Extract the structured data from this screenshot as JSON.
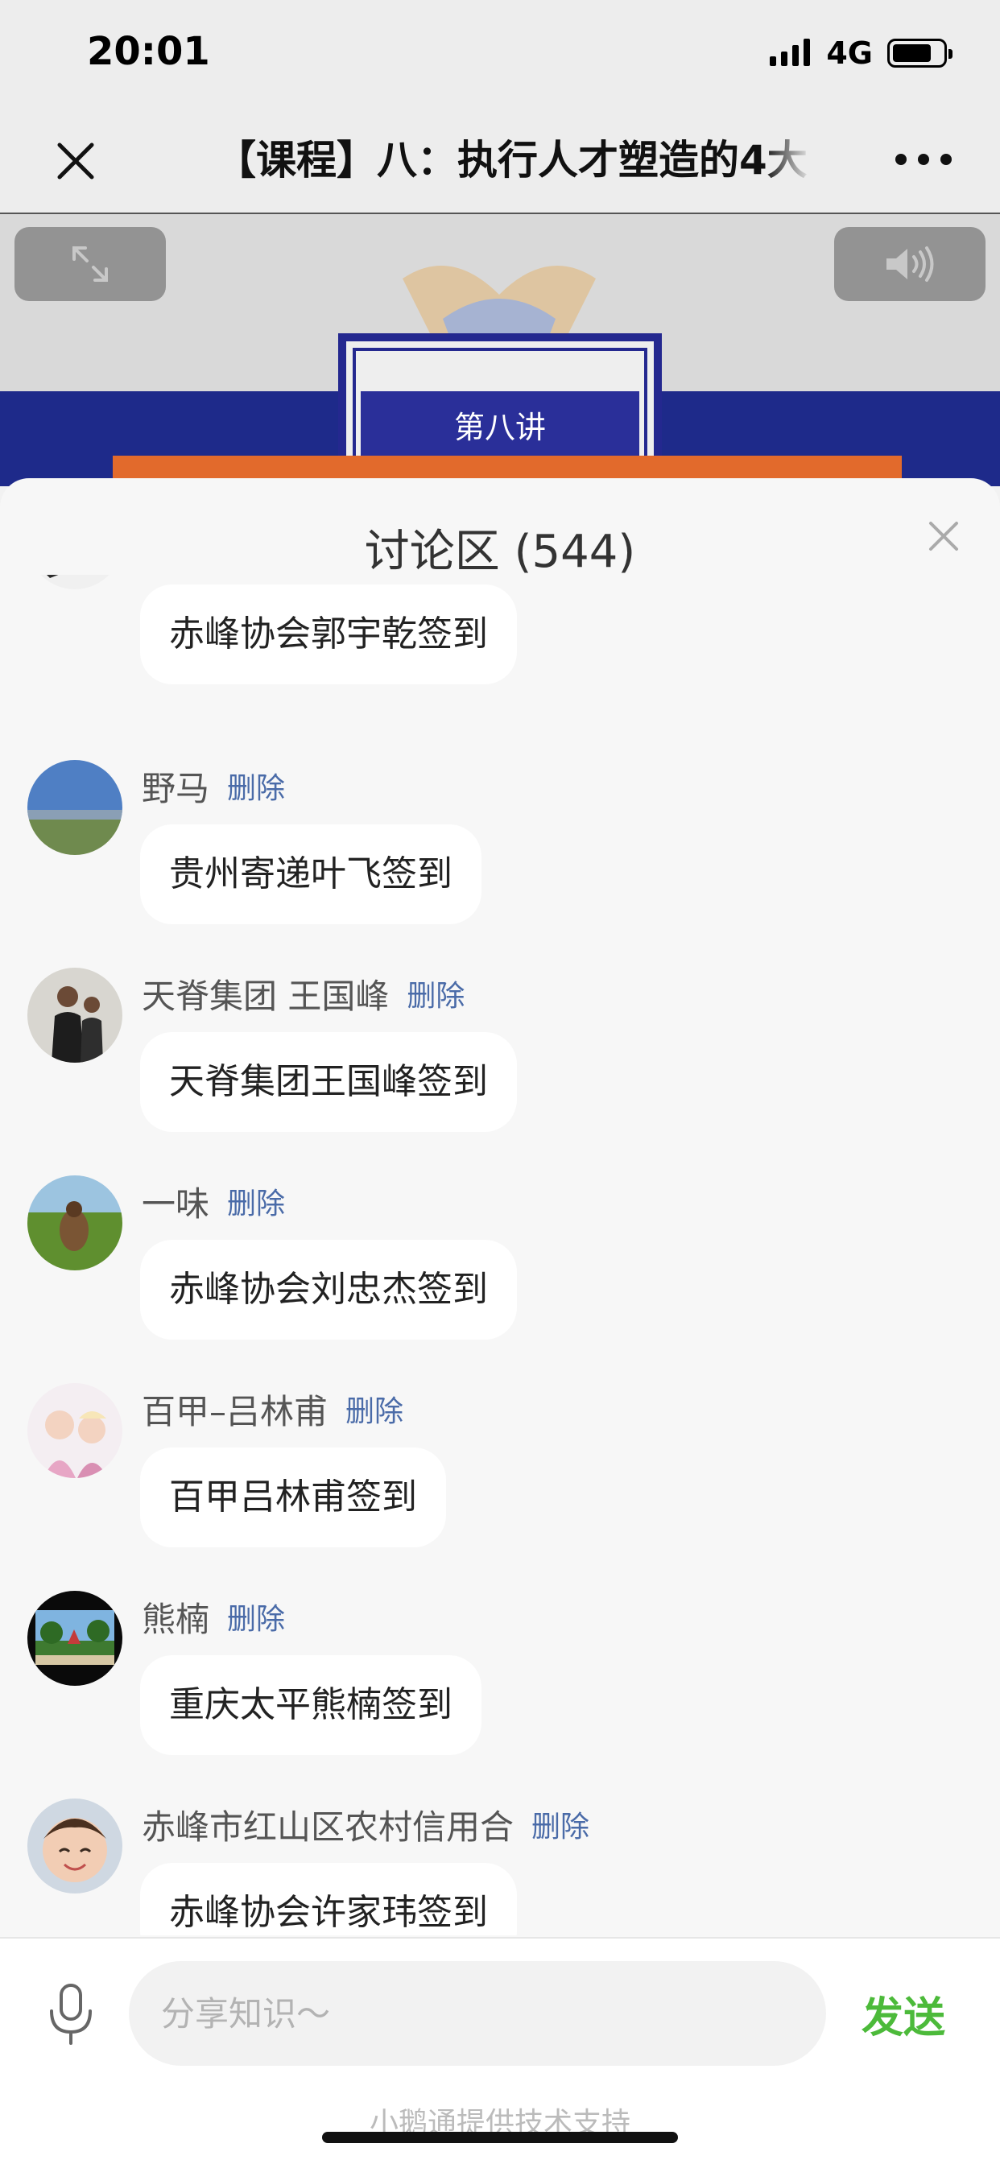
{
  "status_bar": {
    "time": "20:01",
    "network": "4G"
  },
  "nav": {
    "title": "【课程】八：执行人才塑造的4大"
  },
  "video": {
    "caption": "第八讲"
  },
  "discussion": {
    "title": "讨论区 (544)",
    "delete_label": "删除",
    "messages": [
      {
        "name": "",
        "text": "赤峰协会郭宇乾签到"
      },
      {
        "name": "野马",
        "text": "贵州寄递叶飞签到"
      },
      {
        "name": "天脊集团 王国峰",
        "text": "天脊集团王国峰签到"
      },
      {
        "name": "一味",
        "text": "赤峰协会刘忠杰签到"
      },
      {
        "name": "百甲–吕林甫",
        "text": "百甲吕林甫签到"
      },
      {
        "name": "熊楠",
        "text": "重庆太平熊楠签到"
      },
      {
        "name": "赤峰市红山区农村信用合",
        "text": "赤峰协会许家玮签到"
      }
    ]
  },
  "input": {
    "placeholder": "分享知识～",
    "send_label": "发送"
  },
  "footer": {
    "text": "小鹅通提供技术支持"
  },
  "colors": {
    "accent_green": "#4cba3a",
    "delete_link": "#4a6ba8",
    "video_band": "#1e2a8a"
  }
}
